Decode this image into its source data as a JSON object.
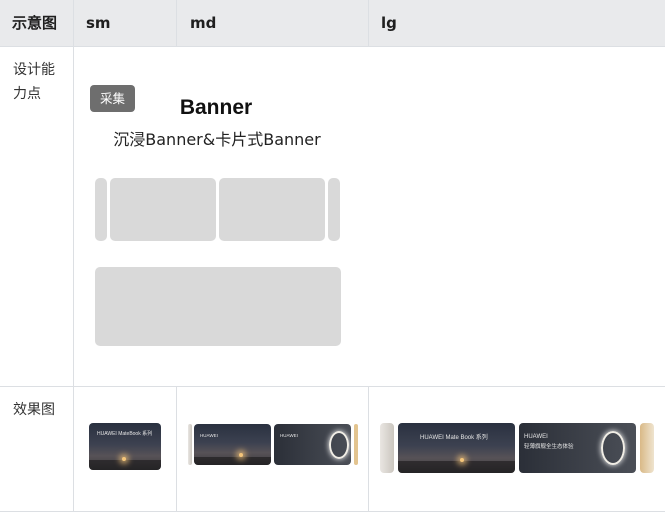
{
  "table": {
    "headers": [
      "示意图",
      "sm",
      "md",
      "lg"
    ],
    "rows": [
      {
        "label_line1": "设计能",
        "label_line2": "力点"
      },
      {
        "label": "效果图"
      }
    ]
  },
  "design": {
    "tag": "采集",
    "title": "Banner",
    "subtitle": "沉浸Banner&卡片式Banner"
  },
  "effects": {
    "sm_caption": "HUAWEI MateBook 系列",
    "md_caption_1": "HUAWEI",
    "md_caption_2": "HUAWEI",
    "lg_caption_1": "HUAWEI Mate Book 系列",
    "lg_caption_2": "HUAWEI",
    "lg_caption_2b": "轻薄旗舰全生态体验"
  }
}
